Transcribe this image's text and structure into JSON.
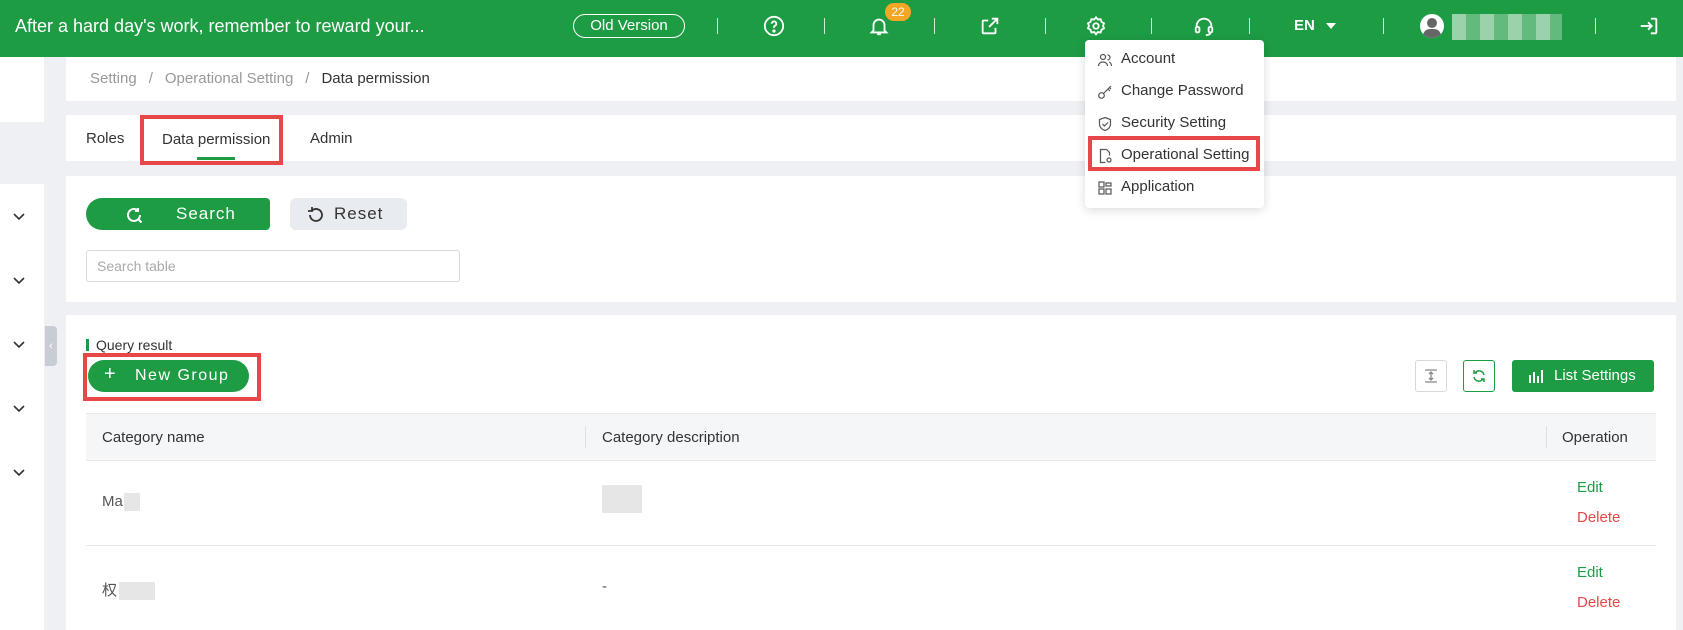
{
  "topbar": {
    "slogan": "After a hard day's work, remember to reward your...",
    "old_version_label": "Old Version",
    "notification_count": "22",
    "language": "EN",
    "colors": {
      "brand": "#1e9c44",
      "badge": "#f5a623",
      "highlight": "#e8474a"
    }
  },
  "breadcrumb": {
    "items": [
      "Setting",
      "Operational Setting",
      "Data permission"
    ],
    "separator": "/"
  },
  "tabs": [
    {
      "label": "Roles"
    },
    {
      "label": "Data permission",
      "active": true
    },
    {
      "label": "Admin"
    }
  ],
  "filter": {
    "search_label": "Search",
    "reset_label": "Reset",
    "search_placeholder": "Search table"
  },
  "result": {
    "title": "Query result",
    "new_group_label": "New Group",
    "list_settings_label": "List Settings",
    "columns": [
      "Category name",
      "Category description",
      "Operation"
    ],
    "rows": [
      {
        "name": "Ma",
        "description": "",
        "edit": "Edit",
        "delete": "Delete"
      },
      {
        "name": "权",
        "description": "-",
        "edit": "Edit",
        "delete": "Delete"
      }
    ]
  },
  "settings_menu": {
    "items": [
      {
        "label": "Account",
        "icon": "users-icon"
      },
      {
        "label": "Change Password",
        "icon": "key-icon"
      },
      {
        "label": "Security Setting",
        "icon": "shield-icon"
      },
      {
        "label": "Operational Setting",
        "icon": "document-gear-icon",
        "highlighted": true
      },
      {
        "label": "Application",
        "icon": "grid-icon"
      }
    ]
  }
}
